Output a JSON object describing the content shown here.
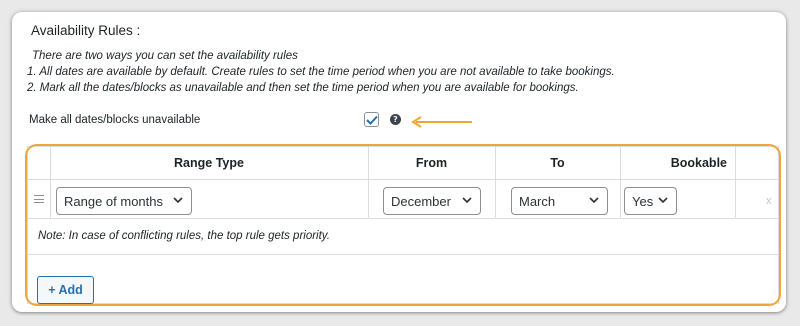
{
  "section": {
    "title": "Availability Rules :",
    "intro_lines": [
      "There are two ways you can set the availability rules",
      "1. All dates are available by default. Create rules to set the time period when you are not available to take bookings.",
      "2. Mark all the dates/blocks as unavailable and then set the time period when you are available for bookings."
    ]
  },
  "make_all_unavailable": {
    "label": "Make all dates/blocks unavailable",
    "checked": true,
    "help_icon": "question-circle-icon"
  },
  "table": {
    "headers": [
      "Range Type",
      "From",
      "To",
      "Bookable"
    ],
    "rows": [
      {
        "range_type": "Range of months",
        "from": "December",
        "to": "March",
        "bookable": "Yes",
        "remove": "x"
      }
    ],
    "note": "Note: In case of conflicting rules, the top rule gets priority.",
    "add_label": "+ Add"
  },
  "colors": {
    "accent": "#2271b1",
    "highlight": "#f0a53b"
  }
}
